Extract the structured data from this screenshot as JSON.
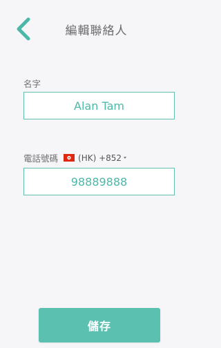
{
  "header": {
    "title": "編輯聯絡人",
    "back_icon": "chevron-left-icon"
  },
  "form": {
    "name_label": "名字",
    "name_value": "Alan Tam",
    "phone_label": "電話號碼",
    "country_flag_icon": "hong-kong-flag-icon",
    "country_code": "(HK) +852",
    "phone_value": "98889888"
  },
  "actions": {
    "save_label": "儲存"
  },
  "colors": {
    "accent": "#5cc0b0",
    "background": "#f6f6f9"
  }
}
